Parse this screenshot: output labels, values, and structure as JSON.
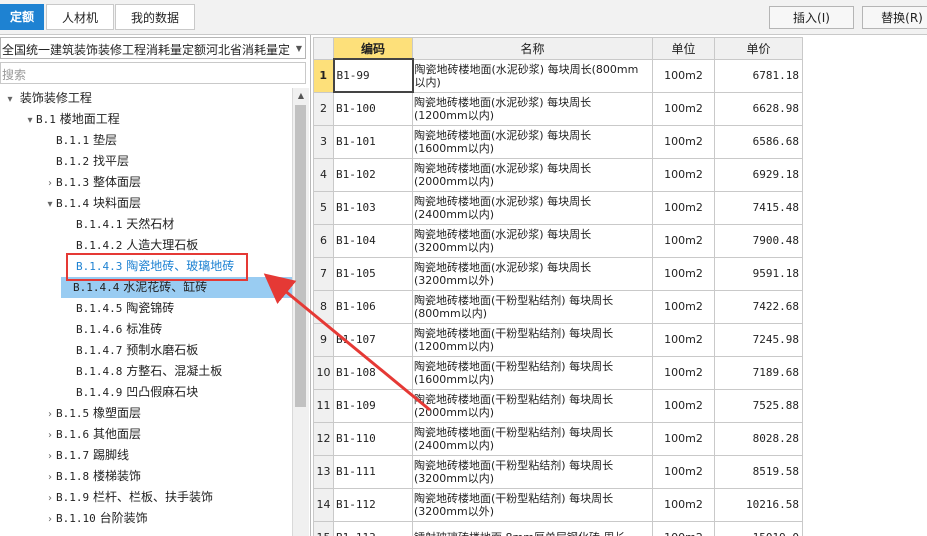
{
  "top_tabs": {
    "tab1": "定额",
    "tab2": "人材机",
    "tab3": "我的数据"
  },
  "toolbar": {
    "insert_label": "插入(I)",
    "replace_label": "替换(R)"
  },
  "library": {
    "selected": "全国统一建筑装饰装修工程消耗量定额河北省消耗量定额",
    "search_placeholder": "搜索"
  },
  "tree": [
    {
      "code": "",
      "label": "装饰装修工程",
      "exp": "▾"
    },
    {
      "code": "B.1",
      "label": "楼地面工程",
      "exp": "▾"
    },
    {
      "code": "B.1.1",
      "label": "垫层",
      "exp": ""
    },
    {
      "code": "B.1.2",
      "label": "找平层",
      "exp": ""
    },
    {
      "code": "B.1.3",
      "label": "整体面层",
      "exp": "›"
    },
    {
      "code": "B.1.4",
      "label": "块料面层",
      "exp": "▾"
    },
    {
      "code": "B.1.4.1",
      "label": "天然石材",
      "exp": ""
    },
    {
      "code": "B.1.4.2",
      "label": "人造大理石板",
      "exp": ""
    },
    {
      "code": "B.1.4.3",
      "label": "陶瓷地砖、玻璃地砖",
      "exp": ""
    },
    {
      "code": "B.1.4.4",
      "label": "水泥花砖、缸砖",
      "exp": ""
    },
    {
      "code": "B.1.4.5",
      "label": "陶瓷锦砖",
      "exp": ""
    },
    {
      "code": "B.1.4.6",
      "label": "标准砖",
      "exp": ""
    },
    {
      "code": "B.1.4.7",
      "label": "预制水磨石板",
      "exp": ""
    },
    {
      "code": "B.1.4.8",
      "label": "方整石、混凝土板",
      "exp": ""
    },
    {
      "code": "B.1.4.9",
      "label": "凹凸假麻石块",
      "exp": ""
    },
    {
      "code": "B.1.5",
      "label": "橡塑面层",
      "exp": "›"
    },
    {
      "code": "B.1.6",
      "label": "其他面层",
      "exp": "›"
    },
    {
      "code": "B.1.7",
      "label": "踢脚线",
      "exp": "›"
    },
    {
      "code": "B.1.8",
      "label": "楼梯装饰",
      "exp": "›"
    },
    {
      "code": "B.1.9",
      "label": "栏杆、栏板、扶手装饰",
      "exp": "›"
    },
    {
      "code": "B.1.10",
      "label": "台阶装饰",
      "exp": "›"
    }
  ],
  "grid": {
    "headers": {
      "code": "编码",
      "name": "名称",
      "unit": "单位",
      "price": "单价"
    },
    "rows": [
      {
        "num": "1",
        "code": "B1-99",
        "name1": "陶瓷地砖楼地面(水泥砂浆) 每块周长(800mm",
        "name2": "以内)",
        "unit": "100m2",
        "price": "6781.18"
      },
      {
        "num": "2",
        "code": "B1-100",
        "name1": "陶瓷地砖楼地面(水泥砂浆) 每块周长",
        "name2": "(1200mm以内)",
        "unit": "100m2",
        "price": "6628.98"
      },
      {
        "num": "3",
        "code": "B1-101",
        "name1": "陶瓷地砖楼地面(水泥砂浆) 每块周长",
        "name2": "(1600mm以内)",
        "unit": "100m2",
        "price": "6586.68"
      },
      {
        "num": "4",
        "code": "B1-102",
        "name1": "陶瓷地砖楼地面(水泥砂浆) 每块周长",
        "name2": "(2000mm以内)",
        "unit": "100m2",
        "price": "6929.18"
      },
      {
        "num": "5",
        "code": "B1-103",
        "name1": "陶瓷地砖楼地面(水泥砂浆) 每块周长",
        "name2": "(2400mm以内)",
        "unit": "100m2",
        "price": "7415.48"
      },
      {
        "num": "6",
        "code": "B1-104",
        "name1": "陶瓷地砖楼地面(水泥砂浆) 每块周长",
        "name2": "(3200mm以内)",
        "unit": "100m2",
        "price": "7900.48"
      },
      {
        "num": "7",
        "code": "B1-105",
        "name1": "陶瓷地砖楼地面(水泥砂浆) 每块周长",
        "name2": "(3200mm以外)",
        "unit": "100m2",
        "price": "9591.18"
      },
      {
        "num": "8",
        "code": "B1-106",
        "name1": "陶瓷地砖楼地面(干粉型粘结剂) 每块周长",
        "name2": "(800mm以内)",
        "unit": "100m2",
        "price": "7422.68"
      },
      {
        "num": "9",
        "code": "B1-107",
        "name1": "陶瓷地砖楼地面(干粉型粘结剂) 每块周长",
        "name2": "(1200mm以内)",
        "unit": "100m2",
        "price": "7245.98"
      },
      {
        "num": "10",
        "code": "B1-108",
        "name1": "陶瓷地砖楼地面(干粉型粘结剂) 每块周长",
        "name2": "(1600mm以内)",
        "unit": "100m2",
        "price": "7189.68"
      },
      {
        "num": "11",
        "code": "B1-109",
        "name1": "陶瓷地砖楼地面(干粉型粘结剂) 每块周长",
        "name2": "(2000mm以内)",
        "unit": "100m2",
        "price": "7525.88"
      },
      {
        "num": "12",
        "code": "B1-110",
        "name1": "陶瓷地砖楼地面(干粉型粘结剂) 每块周长",
        "name2": "(2400mm以内)",
        "unit": "100m2",
        "price": "8028.28"
      },
      {
        "num": "13",
        "code": "B1-111",
        "name1": "陶瓷地砖楼地面(干粉型粘结剂) 每块周长",
        "name2": "(3200mm以内)",
        "unit": "100m2",
        "price": "8519.58"
      },
      {
        "num": "14",
        "code": "B1-112",
        "name1": "陶瓷地砖楼地面(干粉型粘结剂) 每块周长",
        "name2": "(3200mm以外)",
        "unit": "100m2",
        "price": "10216.58"
      },
      {
        "num": "15",
        "code": "B1-113",
        "name1": "镭射玻璃砖楼地面 8mm厚单层钢化砖 周长",
        "name2": "",
        "unit": "100m2",
        "price": "15019.0"
      }
    ]
  },
  "colors": {
    "accent": "#1e82d2",
    "header_yellow": "#fde07a",
    "selection": "#99ccf2",
    "annotation_red": "#e53935"
  }
}
